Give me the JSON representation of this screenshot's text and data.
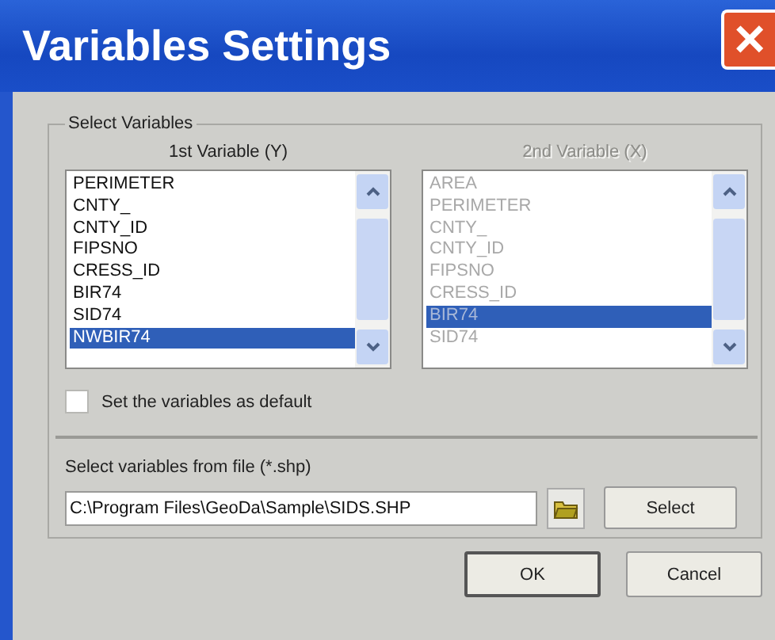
{
  "window": {
    "title": "Variables Settings",
    "close": "×"
  },
  "group": {
    "label": "Select Variables"
  },
  "lists": [
    {
      "label": "1st Variable (Y)",
      "disabled": false,
      "items": [
        {
          "label": "PERIMETER",
          "selected": false
        },
        {
          "label": "CNTY_",
          "selected": false
        },
        {
          "label": "CNTY_ID",
          "selected": false
        },
        {
          "label": "FIPSNO",
          "selected": false
        },
        {
          "label": "CRESS_ID",
          "selected": false
        },
        {
          "label": "BIR74",
          "selected": false
        },
        {
          "label": "SID74",
          "selected": false
        },
        {
          "label": "NWBIR74",
          "selected": true
        }
      ]
    },
    {
      "label": "2nd Variable (X)",
      "disabled": true,
      "items": [
        {
          "label": "AREA",
          "selected": false
        },
        {
          "label": "PERIMETER",
          "selected": false
        },
        {
          "label": "CNTY_",
          "selected": false
        },
        {
          "label": "CNTY_ID",
          "selected": false
        },
        {
          "label": "FIPSNO",
          "selected": false
        },
        {
          "label": "CRESS_ID",
          "selected": false
        },
        {
          "label": "BIR74",
          "selected": true
        },
        {
          "label": "SID74",
          "selected": false
        }
      ]
    }
  ],
  "checkbox": {
    "label": "Set the variables as default",
    "checked": false
  },
  "file": {
    "label": "Select variables from file (*.shp)",
    "value": "C:\\Program Files\\GeoDa\\Sample\\SIDS.SHP",
    "button": "Select"
  },
  "buttons": [
    "OK",
    "Cancel"
  ]
}
